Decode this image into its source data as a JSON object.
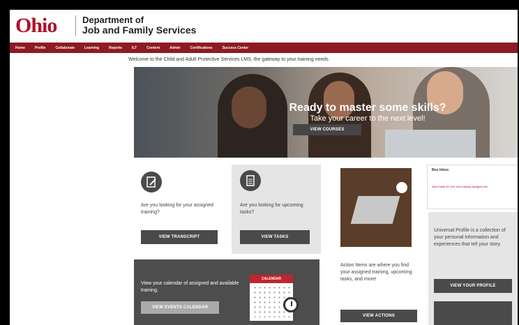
{
  "header": {
    "logo_text": "Ohio",
    "dept_line1": "Department of",
    "dept_line2": "Job and Family Services"
  },
  "nav": {
    "items": [
      "Home",
      "Profile",
      "Collaborate",
      "Learning",
      "Reports",
      "ILT",
      "Content",
      "Admin",
      "Certifications",
      "Success Center"
    ]
  },
  "welcome": "Welcome to the Child and Adult Protective Services LMS, the gateway to your training needs.",
  "hero": {
    "title": "Ready to master some skills?",
    "subtitle": "Take your career to the next level!",
    "button": "VIEW COURSES"
  },
  "transcript_card": {
    "text": "Are you looking for your assigned training?",
    "button": "VIEW TRANSCRIPT"
  },
  "tasks_card": {
    "text": "Are you looking for upcoming tasks?",
    "button": "VIEW TASKS"
  },
  "actions": {
    "text": "Action Items are where you find your assigned training, upcoming tasks, and more!",
    "button": "VIEW ACTIONS"
  },
  "inbox": {
    "title": "Box Inbox",
    "item": "New Email 55 Your new training assigned etc."
  },
  "profile": {
    "text": "Universal Profile is a collection of your personal information and experiences that tell your story.",
    "button": "VIEW YOUR PROFILE"
  },
  "calendar": {
    "text": "View your calendar of assigned and available training.",
    "button": "VIEW EVENTS CALENDAR",
    "icon_label": "CALENDAR"
  },
  "colors": {
    "brand_red": "#8e1a22",
    "logo_red": "#b0102a",
    "button_dark": "#4a4a4a"
  }
}
